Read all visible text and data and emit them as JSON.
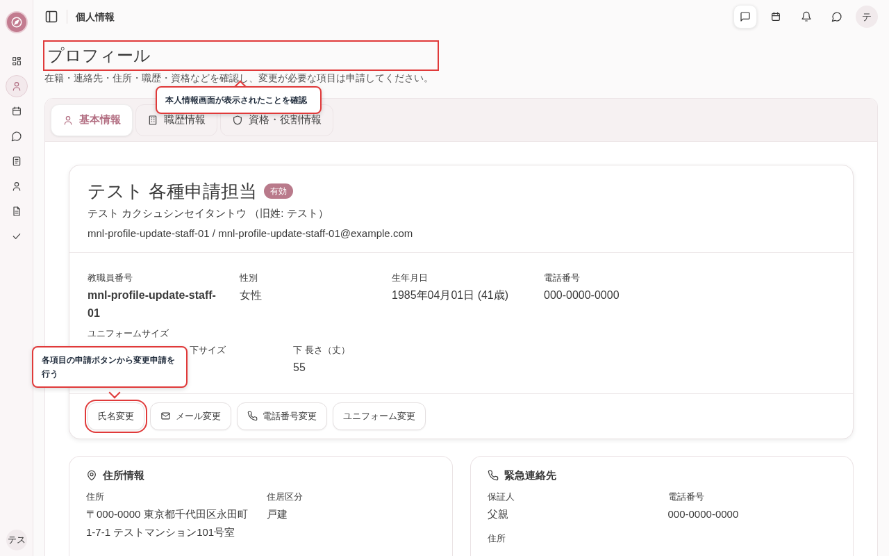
{
  "header": {
    "title": "個人情報"
  },
  "sidebar": {
    "items": [
      {
        "kind": "grid",
        "selected": false
      },
      {
        "kind": "person",
        "selected": true
      },
      {
        "kind": "calendar",
        "selected": false
      },
      {
        "kind": "chat",
        "selected": false
      },
      {
        "kind": "book",
        "selected": false
      },
      {
        "kind": "person",
        "selected": false
      },
      {
        "kind": "document",
        "selected": false
      },
      {
        "kind": "check",
        "selected": false
      }
    ],
    "user": "テス"
  },
  "toolbar": {
    "items": [
      {
        "kind": "message",
        "selected": true
      },
      {
        "kind": "calendar",
        "selected": false
      },
      {
        "kind": "bell",
        "selected": false
      },
      {
        "kind": "chat",
        "selected": false
      }
    ],
    "avatar": "テ"
  },
  "page": {
    "title": "プロフィール",
    "title_highlighted": true,
    "subtitle": "在籍・連絡先・住所・職歴・資格などを確認し、変更が必要な項目は申請してください。"
  },
  "tabs": [
    {
      "label": "基本情報",
      "kind": "person",
      "selected": true
    },
    {
      "label": "職歴情報",
      "kind": "building",
      "selected": false
    },
    {
      "label": "資格・役割情報",
      "kind": "shield",
      "selected": false
    }
  ],
  "profile": {
    "name": "テスト 各種申請担当",
    "status": "有効",
    "kana": "テスト カクシュシンセイタントウ （旧姓: テスト）",
    "ids": "mnl-profile-update-staff-01 / mnl-profile-update-staff-01@example.com",
    "fields": [
      {
        "label": "教職員番号",
        "value": "mnl-profile-update-staff-01",
        "bold": true
      },
      {
        "label": "性別",
        "value": "女性",
        "bold": false
      },
      {
        "label": "生年月日",
        "value": "1985年04月01日 (41歳)",
        "bold": false
      },
      {
        "label": "電話番号",
        "value": "000-0000-0000",
        "bold": false
      }
    ],
    "uniform": {
      "label": "ユニフォームサイズ",
      "fields": [
        {
          "label": "下サイズ"
        },
        {
          "label": "下 長さ（丈）",
          "value": "55"
        }
      ]
    },
    "buttons": [
      {
        "label": "氏名変更",
        "highlighted": true
      },
      {
        "label": "メール変更",
        "kind": "mail",
        "highlighted": false
      },
      {
        "label": "電話番号変更",
        "kind": "phone",
        "highlighted": false
      },
      {
        "label": "ユニフォーム変更",
        "highlighted": false
      }
    ]
  },
  "cards": [
    {
      "title": "住所情報",
      "kind": "pin",
      "fields": [
        {
          "label": "住所",
          "value": "〒000-0000 東京都千代田区永田町1-7-1 テストマンション101号室"
        },
        {
          "label": "住居区分",
          "value": "戸建"
        }
      ]
    },
    {
      "title": "緊急連絡先",
      "kind": "phone",
      "fields": [
        {
          "label": "保証人",
          "value": "父親"
        },
        {
          "label": "電話番号",
          "value": "000-0000-0000"
        },
        {
          "label": "住所",
          "wide": true
        }
      ]
    }
  ],
  "callouts": [
    {
      "text": "本人情報画面が表示されたことを確認"
    },
    {
      "text": "各項目の申請ボタンから変更申請を行う"
    }
  ]
}
